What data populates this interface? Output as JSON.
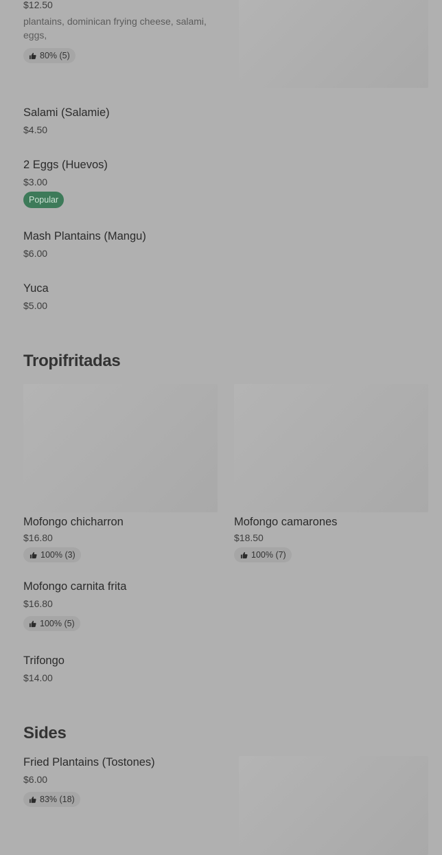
{
  "top_item": {
    "price": "$12.50",
    "description": "plantains, dominican frying cheese, salami, eggs,",
    "rating": "80% (5)"
  },
  "breakfast_items": [
    {
      "name": "Salami (Salamie)",
      "price": "$4.50"
    },
    {
      "name": "2 Eggs (Huevos)",
      "price": "$3.00",
      "badge": "Popular"
    },
    {
      "name": "Mash Plantains (Mangu)",
      "price": "$6.00"
    },
    {
      "name": "Yuca",
      "price": "$5.00"
    }
  ],
  "tropifritadas": {
    "title": "Tropifritadas",
    "cards": [
      {
        "name": "Mofongo chicharron",
        "price": "$16.80",
        "rating": "100% (3)"
      },
      {
        "name": "Mofongo camarones",
        "price": "$18.50",
        "rating": "100% (7)"
      }
    ],
    "items": [
      {
        "name": "Mofongo carnita frita",
        "price": "$16.80",
        "rating": "100% (5)"
      },
      {
        "name": "Trifongo",
        "price": "$14.00"
      }
    ]
  },
  "sides": {
    "title": "Sides",
    "items": [
      {
        "name": "Fried Plantains (Tostones)",
        "price": "$6.00",
        "rating": "83% (18)"
      }
    ]
  },
  "icons": {
    "rating": "thumbs-up-icon"
  },
  "colors": {
    "popular_badge": "#3d7a59",
    "background": "#b0b0b0"
  }
}
